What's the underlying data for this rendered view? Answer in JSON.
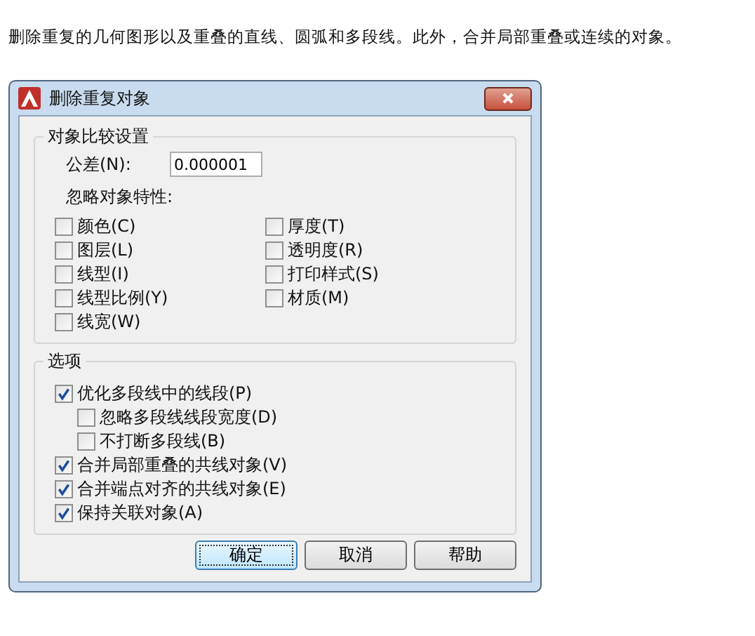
{
  "intro": "删除重复的几何图形以及重叠的直线、圆弧和多段线。此外，合并局部重叠或连续的对象。",
  "window": {
    "title": "删除重复对象"
  },
  "compare_group": {
    "title": "对象比较设置",
    "tolerance_label": "公差(N):",
    "tolerance_value": "0.000001",
    "ignore_label": "忽略对象特性:",
    "ignore_columns": [
      [
        {
          "label": "颜色(C)",
          "checked": false
        },
        {
          "label": "图层(L)",
          "checked": false
        },
        {
          "label": "线型(I)",
          "checked": false
        },
        {
          "label": "线型比例(Y)",
          "checked": false
        },
        {
          "label": "线宽(W)",
          "checked": false
        }
      ],
      [
        {
          "label": "厚度(T)",
          "checked": false
        },
        {
          "label": "透明度(R)",
          "checked": false
        },
        {
          "label": "打印样式(S)",
          "checked": false
        },
        {
          "label": "材质(M)",
          "checked": false
        }
      ]
    ]
  },
  "options_group": {
    "title": "选项",
    "items": [
      {
        "label": "优化多段线中的线段(P)",
        "checked": true,
        "children": [
          {
            "label": "忽略多段线线段宽度(D)",
            "checked": false
          },
          {
            "label": "不打断多段线(B)",
            "checked": false
          }
        ]
      },
      {
        "label": "合并局部重叠的共线对象(V)",
        "checked": true
      },
      {
        "label": "合并端点对齐的共线对象(E)",
        "checked": true
      },
      {
        "label": "保持关联对象(A)",
        "checked": true
      }
    ]
  },
  "buttons": [
    {
      "label": "确定",
      "selected": true
    },
    {
      "label": "取消",
      "selected": false
    },
    {
      "label": "帮助",
      "selected": false
    }
  ]
}
